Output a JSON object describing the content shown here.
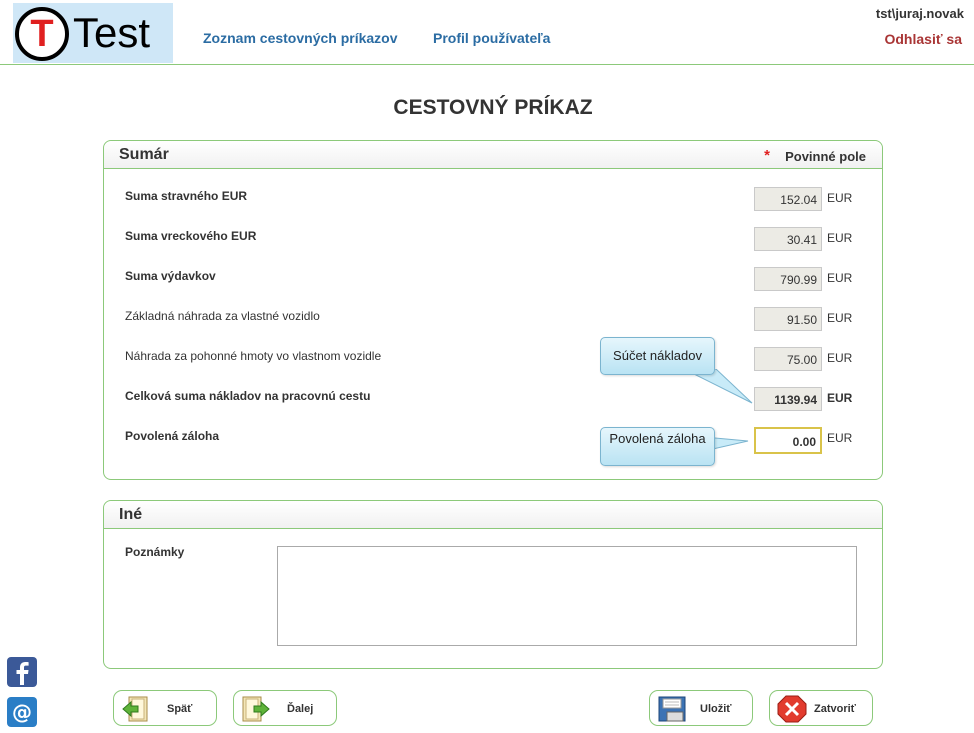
{
  "header": {
    "logo_text": "Test",
    "logo_letter": "T",
    "nav": [
      "Zoznam cestovných príkazov",
      "Profil používateľa"
    ],
    "user": "tst\\juraj.novak",
    "logout": "Odhlasiť sa"
  },
  "page_title": "CESTOVNÝ PRÍKAZ",
  "summary": {
    "title": "Sumár",
    "required_star": "*",
    "required_label": "Povinné pole",
    "unit": "EUR",
    "rows": [
      {
        "label": "Suma stravného EUR",
        "value": "152.04"
      },
      {
        "label": "Suma vreckového EUR",
        "value": "30.41"
      },
      {
        "label": "Suma výdavkov",
        "value": "790.99"
      },
      {
        "label": "Základná náhrada za vlastné vozidlo",
        "value": "91.50"
      },
      {
        "label": "Náhrada za pohonné hmoty vo vlastnom vozidle",
        "value": "75.00"
      },
      {
        "label": "Celková suma nákladov na pracovnú cestu",
        "value": "1139.94"
      },
      {
        "label": "Povolená záloha",
        "value": "0.00"
      }
    ],
    "callouts": {
      "costs": "Súčet nákladov",
      "advance": "Povolená záloha"
    }
  },
  "other": {
    "title": "Iné",
    "notes_label": "Poznámky",
    "notes_value": ""
  },
  "buttons": {
    "back": "Späť",
    "next": "Ďalej",
    "save": "Uložiť",
    "close": "Zatvoriť"
  },
  "social": {
    "facebook_icon": "facebook-icon",
    "email_icon": "email-icon"
  }
}
